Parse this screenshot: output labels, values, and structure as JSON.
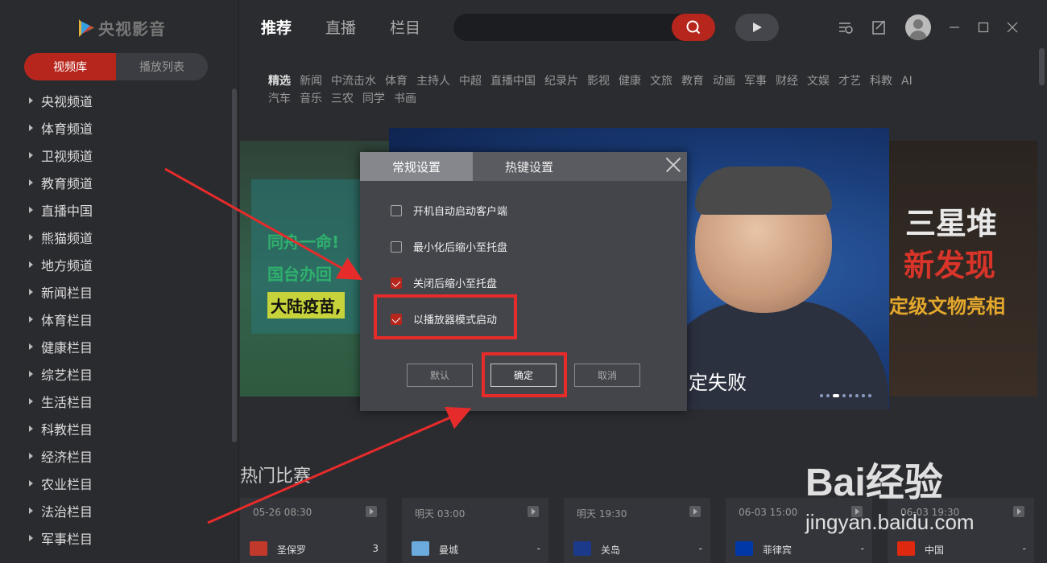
{
  "app": {
    "logo_text": "央视影音"
  },
  "sidebar": {
    "tabs": [
      {
        "label": "视频库",
        "active": true
      },
      {
        "label": "播放列表",
        "active": false
      }
    ],
    "items": [
      "央视频道",
      "体育频道",
      "卫视频道",
      "教育频道",
      "直播中国",
      "熊猫频道",
      "地方频道",
      "新闻栏目",
      "体育栏目",
      "健康栏目",
      "综艺栏目",
      "生活栏目",
      "科教栏目",
      "经济栏目",
      "农业栏目",
      "法治栏目",
      "军事栏目"
    ]
  },
  "header": {
    "tabs": [
      {
        "label": "推荐",
        "active": true
      },
      {
        "label": "直播"
      },
      {
        "label": "栏目"
      }
    ],
    "search": {
      "placeholder": ""
    }
  },
  "categories": [
    "精选",
    "新闻",
    "中流击水",
    "体育",
    "主持人",
    "中超",
    "直播中国",
    "纪录片",
    "影视",
    "健康",
    "文旅",
    "教育",
    "动画",
    "军事",
    "财经",
    "文娱",
    "才艺",
    "科教",
    "AI",
    "汽车",
    "音乐",
    "三农",
    "同学",
    "书画"
  ],
  "banner": {
    "left": {
      "line1": "同舟一命!",
      "line2": "国台办回",
      "line3": "大陆疫苗,"
    },
    "main": {
      "caption": "定失败",
      "slide_count": 8,
      "active_slide": 3
    },
    "right": {
      "line1": "三星堆",
      "line2": "新发现",
      "line3": "定级文物亮相"
    }
  },
  "hot_matches": {
    "title": "热门比赛",
    "items": [
      {
        "time": "05-26 08:30",
        "team": "圣保罗",
        "score": "3",
        "flag_color": "#c0392b"
      },
      {
        "time": "明天 03:00",
        "team": "曼城",
        "score": "-",
        "flag_color": "#6cabdd"
      },
      {
        "time": "明天 19:30",
        "team": "关岛",
        "score": "-",
        "flag_color": "#1b3a8a"
      },
      {
        "time": "06-03 15:00",
        "team": "菲律宾",
        "score": "-",
        "flag_color": "#0038a8"
      },
      {
        "time": "06-03 19:30",
        "team": "中国",
        "score": "-",
        "flag_color": "#de2910"
      }
    ]
  },
  "dialog": {
    "tabs": [
      {
        "label": "常规设置",
        "active": true
      },
      {
        "label": "热键设置",
        "active": false
      }
    ],
    "options": [
      {
        "label": "开机自动启动客户端",
        "checked": false
      },
      {
        "label": "最小化后缩小至托盘",
        "checked": false
      },
      {
        "label": "关闭后缩小至托盘",
        "checked": true
      },
      {
        "label": "以播放器模式启动",
        "checked": true
      }
    ],
    "buttons": {
      "default": "默认",
      "ok": "确定",
      "cancel": "取消"
    }
  },
  "watermark": {
    "brand": "Bai经验",
    "url": "jingyan.baidu.com"
  },
  "colors": {
    "accent": "#b7261d",
    "annotation": "#e62b2b"
  }
}
